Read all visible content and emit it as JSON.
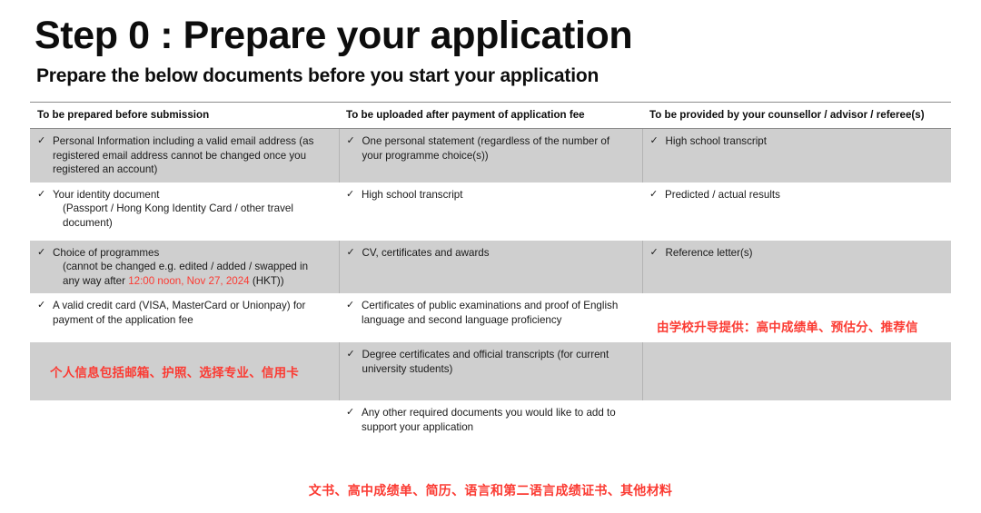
{
  "slide": {
    "title": "Step 0 : Prepare your application",
    "subtitle": "Prepare the below documents before you start your application"
  },
  "table": {
    "headers": [
      "To be prepared before submission",
      "To be uploaded after payment of application fee",
      "To be provided by your counsellor / advisor / referee(s)"
    ],
    "check_glyph": "✓",
    "rows": [
      {
        "banded": true,
        "c1": "Personal Information including a valid email address (as registered email address cannot be changed once you registered an account)",
        "c2": "One personal statement (regardless of the number of your programme choice(s))",
        "c3": "High school transcript"
      },
      {
        "banded": false,
        "c1_main": "Your identity document",
        "c1_indent": "(Passport / Hong Kong Identity Card / other travel document)",
        "c2": "High school transcript",
        "c3": "Predicted / actual results"
      },
      {
        "banded": true,
        "c1_main": "Choice of programmes",
        "c1_indent_pre": "(cannot be changed e.g. edited / added / swapped in any way after ",
        "c1_indent_red": "12:00 noon, Nov 27, 2024",
        "c1_indent_post": " (HKT))",
        "c2": "CV, certificates and awards",
        "c3": "Reference letter(s)"
      },
      {
        "banded": false,
        "c1": "A valid credit card (VISA, MasterCard or Unionpay) for payment of the application fee",
        "c2": "Certificates of public examinations and proof of English language and second language proficiency",
        "c3_note": "由学校升导提供：高中成绩单、预估分、推荐信"
      },
      {
        "banded": true,
        "c1_note": "个人信息包括邮箱、护照、选择专业、信用卡",
        "c2": "Degree certificates and official transcripts (for current university students)",
        "c3": ""
      },
      {
        "banded": false,
        "c1": "",
        "c2": "Any other required documents you would like to add to support your application",
        "c3": ""
      }
    ]
  },
  "bottom_note": "文书、高中成绩单、简历、语言和第二语言成绩证书、其他材料",
  "colors": {
    "band": "#cfcfcf",
    "accent_red": "#fb3b33",
    "text": "#1a1a1a",
    "rule": "#8c8c8c"
  }
}
